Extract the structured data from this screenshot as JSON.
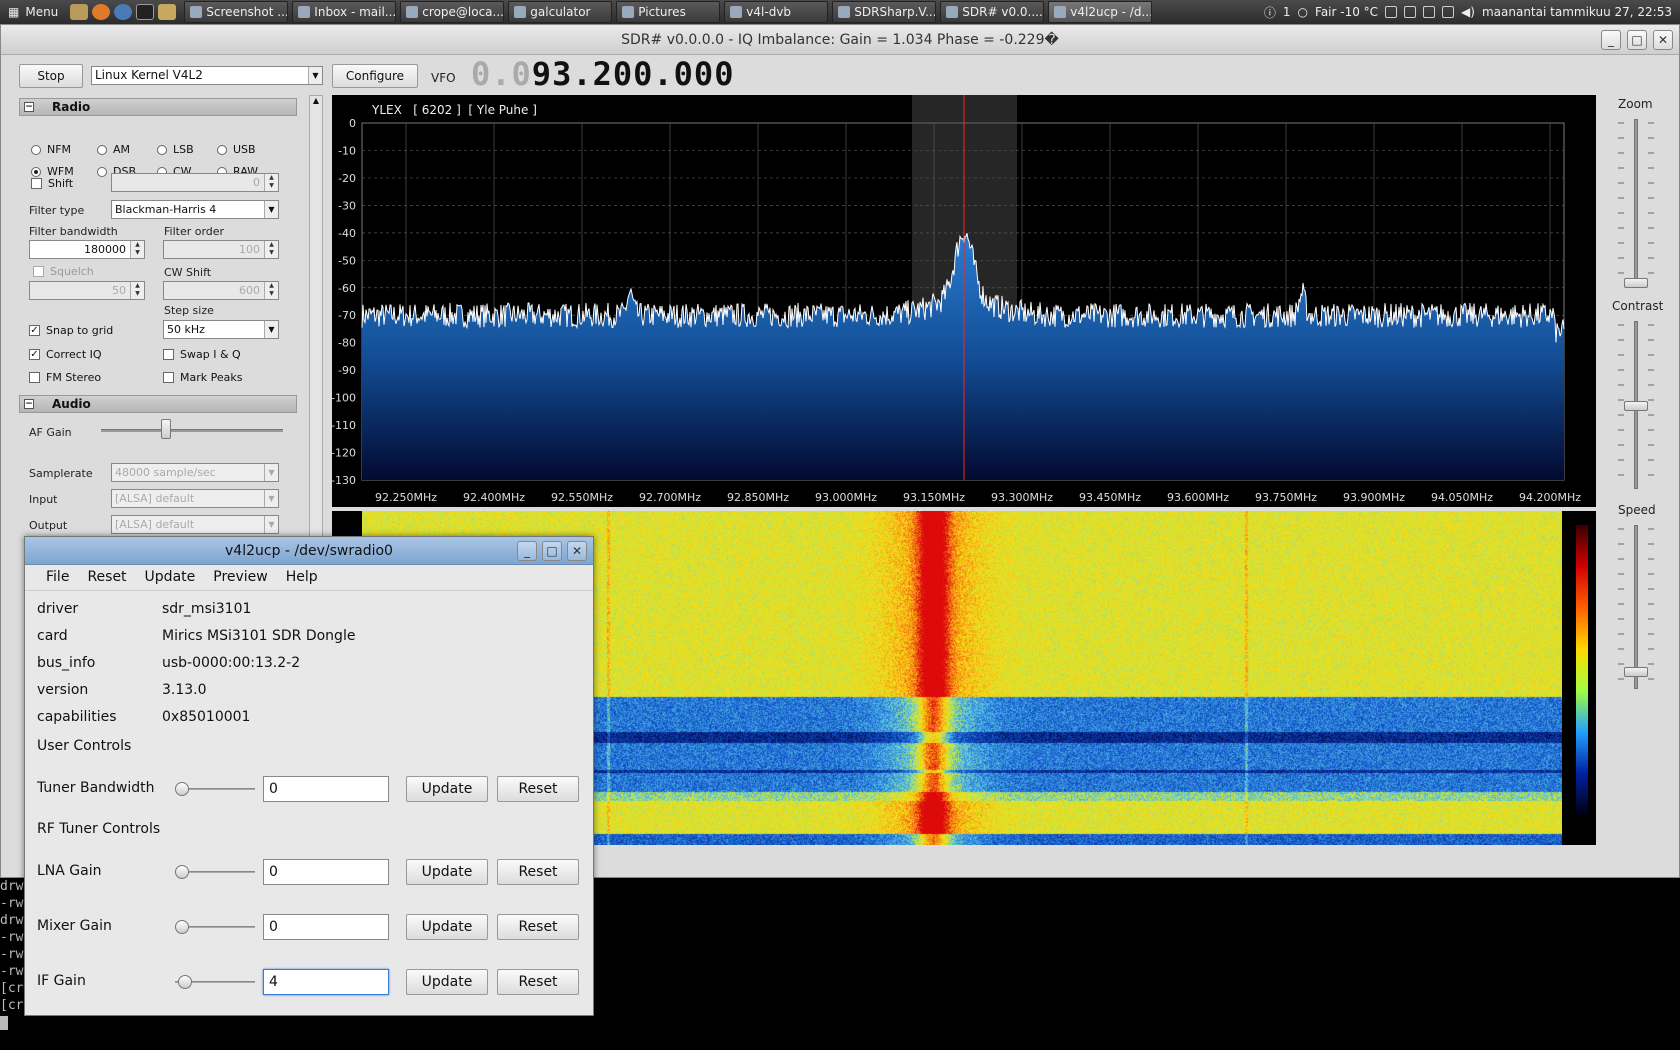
{
  "taskbar": {
    "menu_label": "Menu",
    "tasks": [
      {
        "label": "Screenshot ...",
        "active": false
      },
      {
        "label": "Inbox - mail...",
        "active": false
      },
      {
        "label": "crope@loca...",
        "active": false
      },
      {
        "label": "galculator",
        "active": false
      },
      {
        "label": "Pictures",
        "active": false
      },
      {
        "label": "v4l-dvb",
        "active": false
      },
      {
        "label": "SDRSharp.V...",
        "active": false
      },
      {
        "label": "SDR# v0.0....",
        "active": false
      },
      {
        "label": "v4l2ucp - /d...",
        "active": true
      }
    ],
    "tray_count": "1",
    "weather": "Fair -10 °C",
    "clock": "maanantai tammikuu 27, 22:53"
  },
  "sdr": {
    "title": "SDR# v0.0.0.0 - IQ Imbalance: Gain = 1.034 Phase = -0.229�",
    "stop_label": "Stop",
    "source": "Linux Kernel V4L2",
    "configure_label": "Configure",
    "vfo_label": "VFO",
    "vfo_dim": "0.0",
    "vfo_value": "93.200.000",
    "radio_section": "Radio",
    "modes": [
      {
        "label": "NFM",
        "on": false
      },
      {
        "label": "AM",
        "on": false
      },
      {
        "label": "LSB",
        "on": false
      },
      {
        "label": "USB",
        "on": false
      },
      {
        "label": "WFM",
        "on": true
      },
      {
        "label": "DSB",
        "on": false
      },
      {
        "label": "CW",
        "on": false
      },
      {
        "label": "RAW",
        "on": false
      }
    ],
    "shift_label": "Shift",
    "shift_value": "0",
    "filter_type_label": "Filter type",
    "filter_type": "Blackman-Harris 4",
    "filter_bw_label": "Filter bandwidth",
    "filter_bw": "180000",
    "filter_order_label": "Filter order",
    "filter_order": "100",
    "squelch_label": "Squelch",
    "squelch_value": "50",
    "cw_shift_label": "CW Shift",
    "cw_shift_value": "600",
    "step_size_label": "Step size",
    "step_size": "50 kHz",
    "snap_label": "Snap to grid",
    "correct_iq_label": "Correct IQ",
    "fm_stereo_label": "FM Stereo",
    "swap_iq_label": "Swap I & Q",
    "mark_peaks_label": "Mark Peaks",
    "audio_section": "Audio",
    "af_gain_label": "AF Gain",
    "samplerate_label": "Samplerate",
    "samplerate": "48000 sample/sec",
    "input_label": "Input",
    "input": "[ALSA] default",
    "output_label": "Output",
    "output": "[ALSA] default",
    "zoom_label": "Zoom",
    "contrast_label": "Contrast",
    "speed_label": "Speed"
  },
  "spectrum": {
    "station": "YLEX   [ 6202 ]  [ Yle Puhe ]",
    "y_ticks": [
      "0",
      "-10",
      "-20",
      "-30",
      "-40",
      "-50",
      "-60",
      "-70",
      "-80",
      "-90",
      "-100",
      "-110",
      "-120",
      "-130"
    ],
    "x_ticks": [
      "92.250MHz",
      "92.400MHz",
      "92.550MHz",
      "92.700MHz",
      "92.850MHz",
      "93.000MHz",
      "93.150MHz",
      "93.300MHz",
      "93.450MHz",
      "93.600MHz",
      "93.750MHz",
      "93.900MHz",
      "94.050MHz",
      "94.200MHz"
    ]
  },
  "v4l": {
    "title": "v4l2ucp - /dev/swradio0",
    "menu": [
      "File",
      "Reset",
      "Update",
      "Preview",
      "Help"
    ],
    "info": [
      {
        "key": "driver",
        "value": "sdr_msi3101"
      },
      {
        "key": "card",
        "value": "Mirics MSi3101 SDR Dongle"
      },
      {
        "key": "bus_info",
        "value": "usb-0000:00:13.2-2"
      },
      {
        "key": "version",
        "value": "3.13.0"
      },
      {
        "key": "capabilities",
        "value": "0x85010001"
      }
    ],
    "user_controls": "User Controls",
    "rf_controls": "RF Tuner Controls",
    "update_label": "Update",
    "reset_label": "Reset",
    "controls": [
      {
        "label": "Tuner Bandwidth",
        "value": "0"
      },
      {
        "label": "LNA Gain",
        "value": "0"
      },
      {
        "label": "Mixer Gain",
        "value": "0"
      },
      {
        "label": "IF Gain",
        "value": "4"
      }
    ]
  },
  "terminal": {
    "lines": [
      "drw",
      "-rw",
      "drw",
      "-rw",
      "-rw",
      "-rw",
      "[cr",
      "[cr"
    ]
  },
  "colors": {
    "accent": "#7ea4cf",
    "spectrum_fill": "#1a5fa8",
    "vfo_line": "#ff2020"
  }
}
